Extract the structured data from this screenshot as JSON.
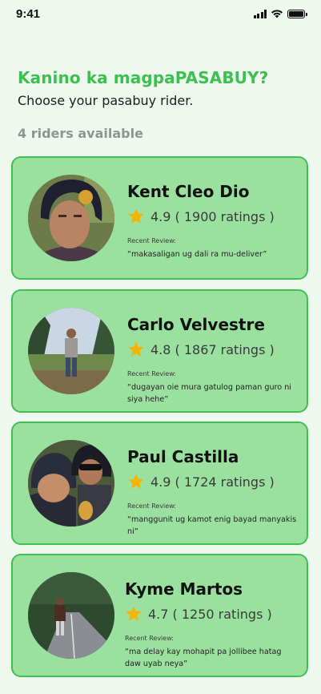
{
  "status": {
    "time": "9:41",
    "icons": [
      "signal-icon",
      "wifi-icon",
      "battery-icon"
    ]
  },
  "header": {
    "title": "Kanino ka magpaPASABUY?",
    "subtitle": "Choose your pasabuy rider.",
    "available": "4 riders available"
  },
  "colors": {
    "accent": "#3cc04e",
    "card": "#9ae1a0",
    "card_border": "#3fc152",
    "star": "#f4b400"
  },
  "riders": [
    {
      "name": "Kent Cleo Dio",
      "rating": "4.9 ( 1900 ratings )",
      "review_label": "Recent Review:",
      "review": "“makasaligan ug dali ra mu-deliver”"
    },
    {
      "name": "Carlo Velvestre",
      "rating": "4.8 ( 1867 ratings )",
      "review_label": "Recent Review:",
      "review": "“dugayan oie mura gatulog paman guro ni siya hehe”"
    },
    {
      "name": "Paul Castilla",
      "rating": "4.9 ( 1724 ratings )",
      "review_label": "Recent Review:",
      "review": "“manggunit ug kamot enig bayad manyakis ni”"
    },
    {
      "name": "Kyme Martos",
      "rating": "4.7 ( 1250 ratings )",
      "review_label": "Recent Review:",
      "review": "“ma delay kay mohapit pa jollibee hatag daw uyab neya”"
    }
  ]
}
